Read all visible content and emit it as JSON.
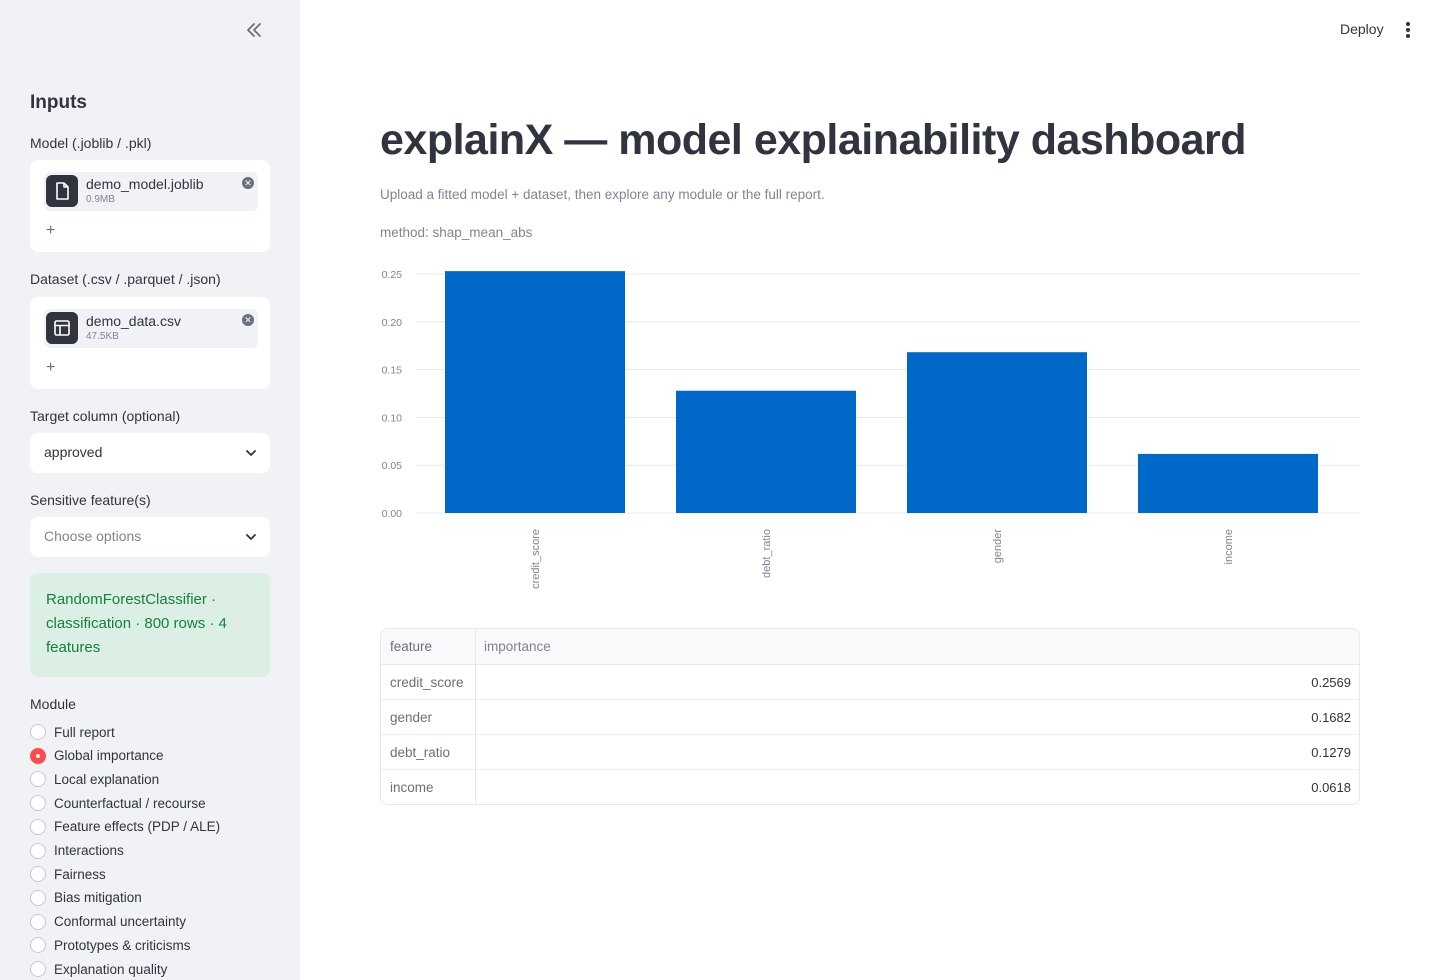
{
  "sidebar": {
    "title": "Inputs",
    "model": {
      "label": "Model (.joblib / .pkl)",
      "file_name": "demo_model.joblib",
      "file_size": "0.9MB",
      "add": "+"
    },
    "dataset": {
      "label": "Dataset (.csv / .parquet / .json)",
      "file_name": "demo_data.csv",
      "file_size": "47.5KB",
      "add": "+"
    },
    "target": {
      "label": "Target column (optional)",
      "value": "approved"
    },
    "sensitive": {
      "label": "Sensitive feature(s)",
      "placeholder": "Choose options"
    },
    "info": "RandomForestClassifier · classification · 800 rows · 4 features",
    "module": {
      "label": "Module",
      "options": [
        "Full report",
        "Global importance",
        "Local explanation",
        "Counterfactual / recourse",
        "Feature effects (PDP / ALE)",
        "Interactions",
        "Fairness",
        "Bias mitigation",
        "Conformal uncertainty",
        "Prototypes & criticisms",
        "Explanation quality"
      ],
      "selected": "Global importance"
    }
  },
  "header": {
    "deploy_label": "Deploy"
  },
  "main": {
    "title": "explainX — model explainability dashboard",
    "subtitle": "Upload a fitted model + dataset, then explore any module or the full report.",
    "method": "method: shap_mean_abs"
  },
  "chart_data": {
    "type": "bar",
    "categories": [
      "credit_score",
      "debt_ratio",
      "gender",
      "income"
    ],
    "values": [
      0.2569,
      0.1279,
      0.1682,
      0.0618
    ],
    "title": "",
    "xlabel": "",
    "ylabel": "",
    "ylim": [
      0,
      0.25
    ],
    "yticks": [
      "0.00",
      "0.05",
      "0.10",
      "0.15",
      "0.20",
      "0.25"
    ],
    "grid": true,
    "bar_color": "#0068c9"
  },
  "table": {
    "headers": [
      "feature",
      "importance"
    ],
    "rows": [
      [
        "credit_score",
        "0.2569"
      ],
      [
        "gender",
        "0.1682"
      ],
      [
        "debt_ratio",
        "0.1279"
      ],
      [
        "income",
        "0.0618"
      ]
    ]
  },
  "colors": {
    "accent": "#ff4b4b",
    "bar": "#0068c9",
    "success_bg": "#dcefe4",
    "success_text": "#17803d",
    "sidebar_bg": "#f0f2f6"
  }
}
